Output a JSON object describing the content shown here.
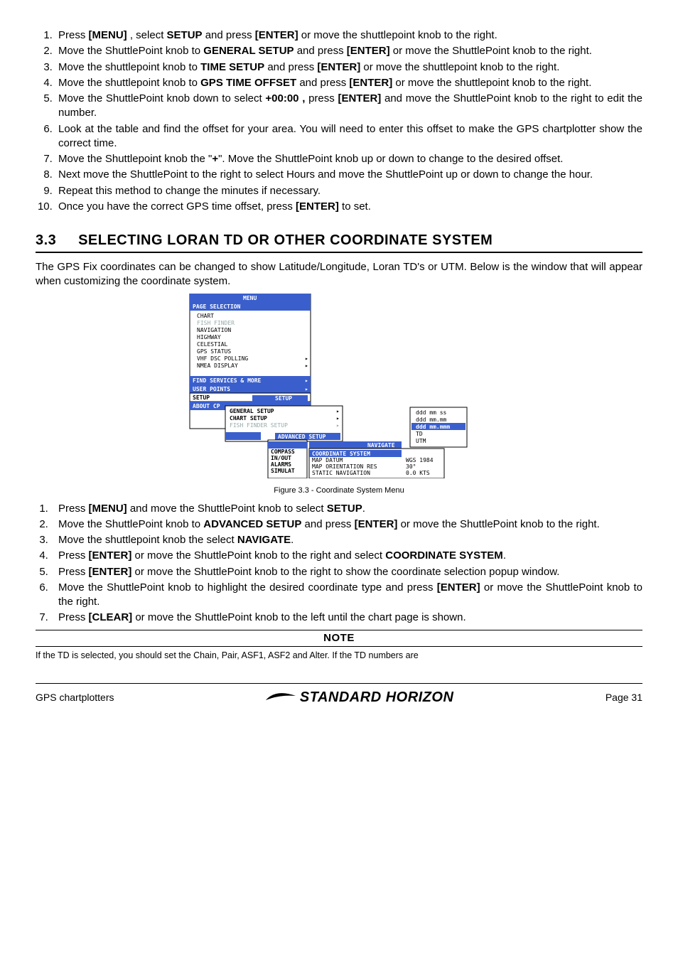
{
  "steps_a": [
    "Press <b>[MENU]</b> , select <b>SETUP</b> and press <b>[ENTER]</b> or move the shuttlepoint knob to the right.",
    "Move the ShuttlePoint knob to <b>GENERAL SETUP</b> and press <b>[ENTER]</b> or move the ShuttlePoint knob to the right.",
    "Move the shuttlepoint knob to <b>TIME SETUP</b> and press <b>[ENTER]</b> or move the shuttlepoint knob to the right.",
    "Move the shuttlepoint knob to <b>GPS TIME OFFSET</b> and press <b>[ENTER]</b> or move the shuttlepoint knob to the right.",
    "Move the ShuttlePoint knob down to select <b>+00:00 ,</b> press <b>[ENTER]</b> and move the ShuttlePoint knob to the right to edit the number.",
    "Look at the table and find the offset for your area. You will need to enter this offset to make the GPS chartplotter show the correct time.",
    "Move the Shuttlepoint knob the \"<b>+</b>\". Move the ShuttlePoint knob up or down to change to the desired offset.",
    "Next move the ShuttlePoint to the right to select Hours and move the ShuttlePoint up or down to change the hour.",
    "Repeat this method to change the minutes if necessary.",
    "Once you have the correct GPS time offset, press <b>[ENTER]</b> to set."
  ],
  "section": {
    "num": "3.3",
    "title": "SELECTING LORAN TD OR OTHER COORDINATE SYSTEM"
  },
  "intro": "The GPS Fix coordinates can be changed to show Latitude/Longitude, Loran TD's or UTM. Below is the window that will appear when customizing the coordinate system.",
  "figure": {
    "caption": "Figure 3.3 - Coordinate System Menu",
    "menu_title": "MENU",
    "page_sel": "PAGE SELECTION",
    "page_items": [
      "CHART",
      "FISH FINDER",
      "NAVIGATION",
      "HIGHWAY",
      "CELESTIAL",
      "GPS STATUS",
      "VHF DSC POLLING",
      "NMEA DISPLAY"
    ],
    "find_bar": "FIND SERVICES & MORE",
    "user_points": "USER POINTS",
    "setup": "SETUP",
    "setup_sub": "SETUP",
    "about": "ABOUT CP",
    "setup_items": [
      "GENERAL SETUP",
      "CHART SETUP",
      "FISH FINDER SETUP",
      "ADVANCE"
    ],
    "adv_bar": "ADVANCED SETUP",
    "adv_items": [
      "NAVIGAT",
      "COMPASS",
      "IN/OUT",
      "ALARMS",
      "SIMULAT"
    ],
    "nav_bar": "NAVIGATE",
    "nav_items": [
      "COORDINATE SYSTEM",
      "MAP DATUM",
      "MAP ORIENTATION RES",
      "STATIC NAVIGATION"
    ],
    "nav_vals": [
      "ddd mm.mmm",
      "WGS 1984",
      "30°",
      "0.0 KTS"
    ],
    "popup_items": [
      "ddd mm ss",
      "ddd mm.mm",
      "ddd mm.mmm",
      "TD",
      "UTM"
    ]
  },
  "steps_b": [
    "Press <b>[MENU]</b>  and move the ShuttlePoint knob to select <b>SETUP</b>.",
    "Move the ShuttlePoint knob to <b>ADVANCED SETUP</b> and press <b>[ENTER]</b> or move the ShuttlePoint knob to the right.",
    "Move the shuttlepoint knob the select <b>NAVIGATE</b>.",
    "Press <b>[ENTER]</b> or move the ShuttlePoint knob to the right and select <b>COORDINATE SYSTEM</b>.",
    "Press <b>[ENTER]</b> or move the ShuttlePoint knob to the right to show the coordinate selection popup window.",
    "Move the ShuttlePoint knob to highlight the desired coordinate type and press <b>[ENTER]</b> or move the ShuttlePoint knob to the right.",
    "Press <b>[CLEAR]</b> or move the ShuttlePoint knob to the left until the chart page is shown."
  ],
  "note": {
    "title": "NOTE",
    "body": "If the TD is selected, you should set the Chain, Pair, ASF1, ASF2 and Alter. If the TD  numbers are"
  },
  "footer": {
    "left": "GPS chartplotters",
    "brand": "STANDARD HORIZON",
    "right": "Page 31"
  }
}
